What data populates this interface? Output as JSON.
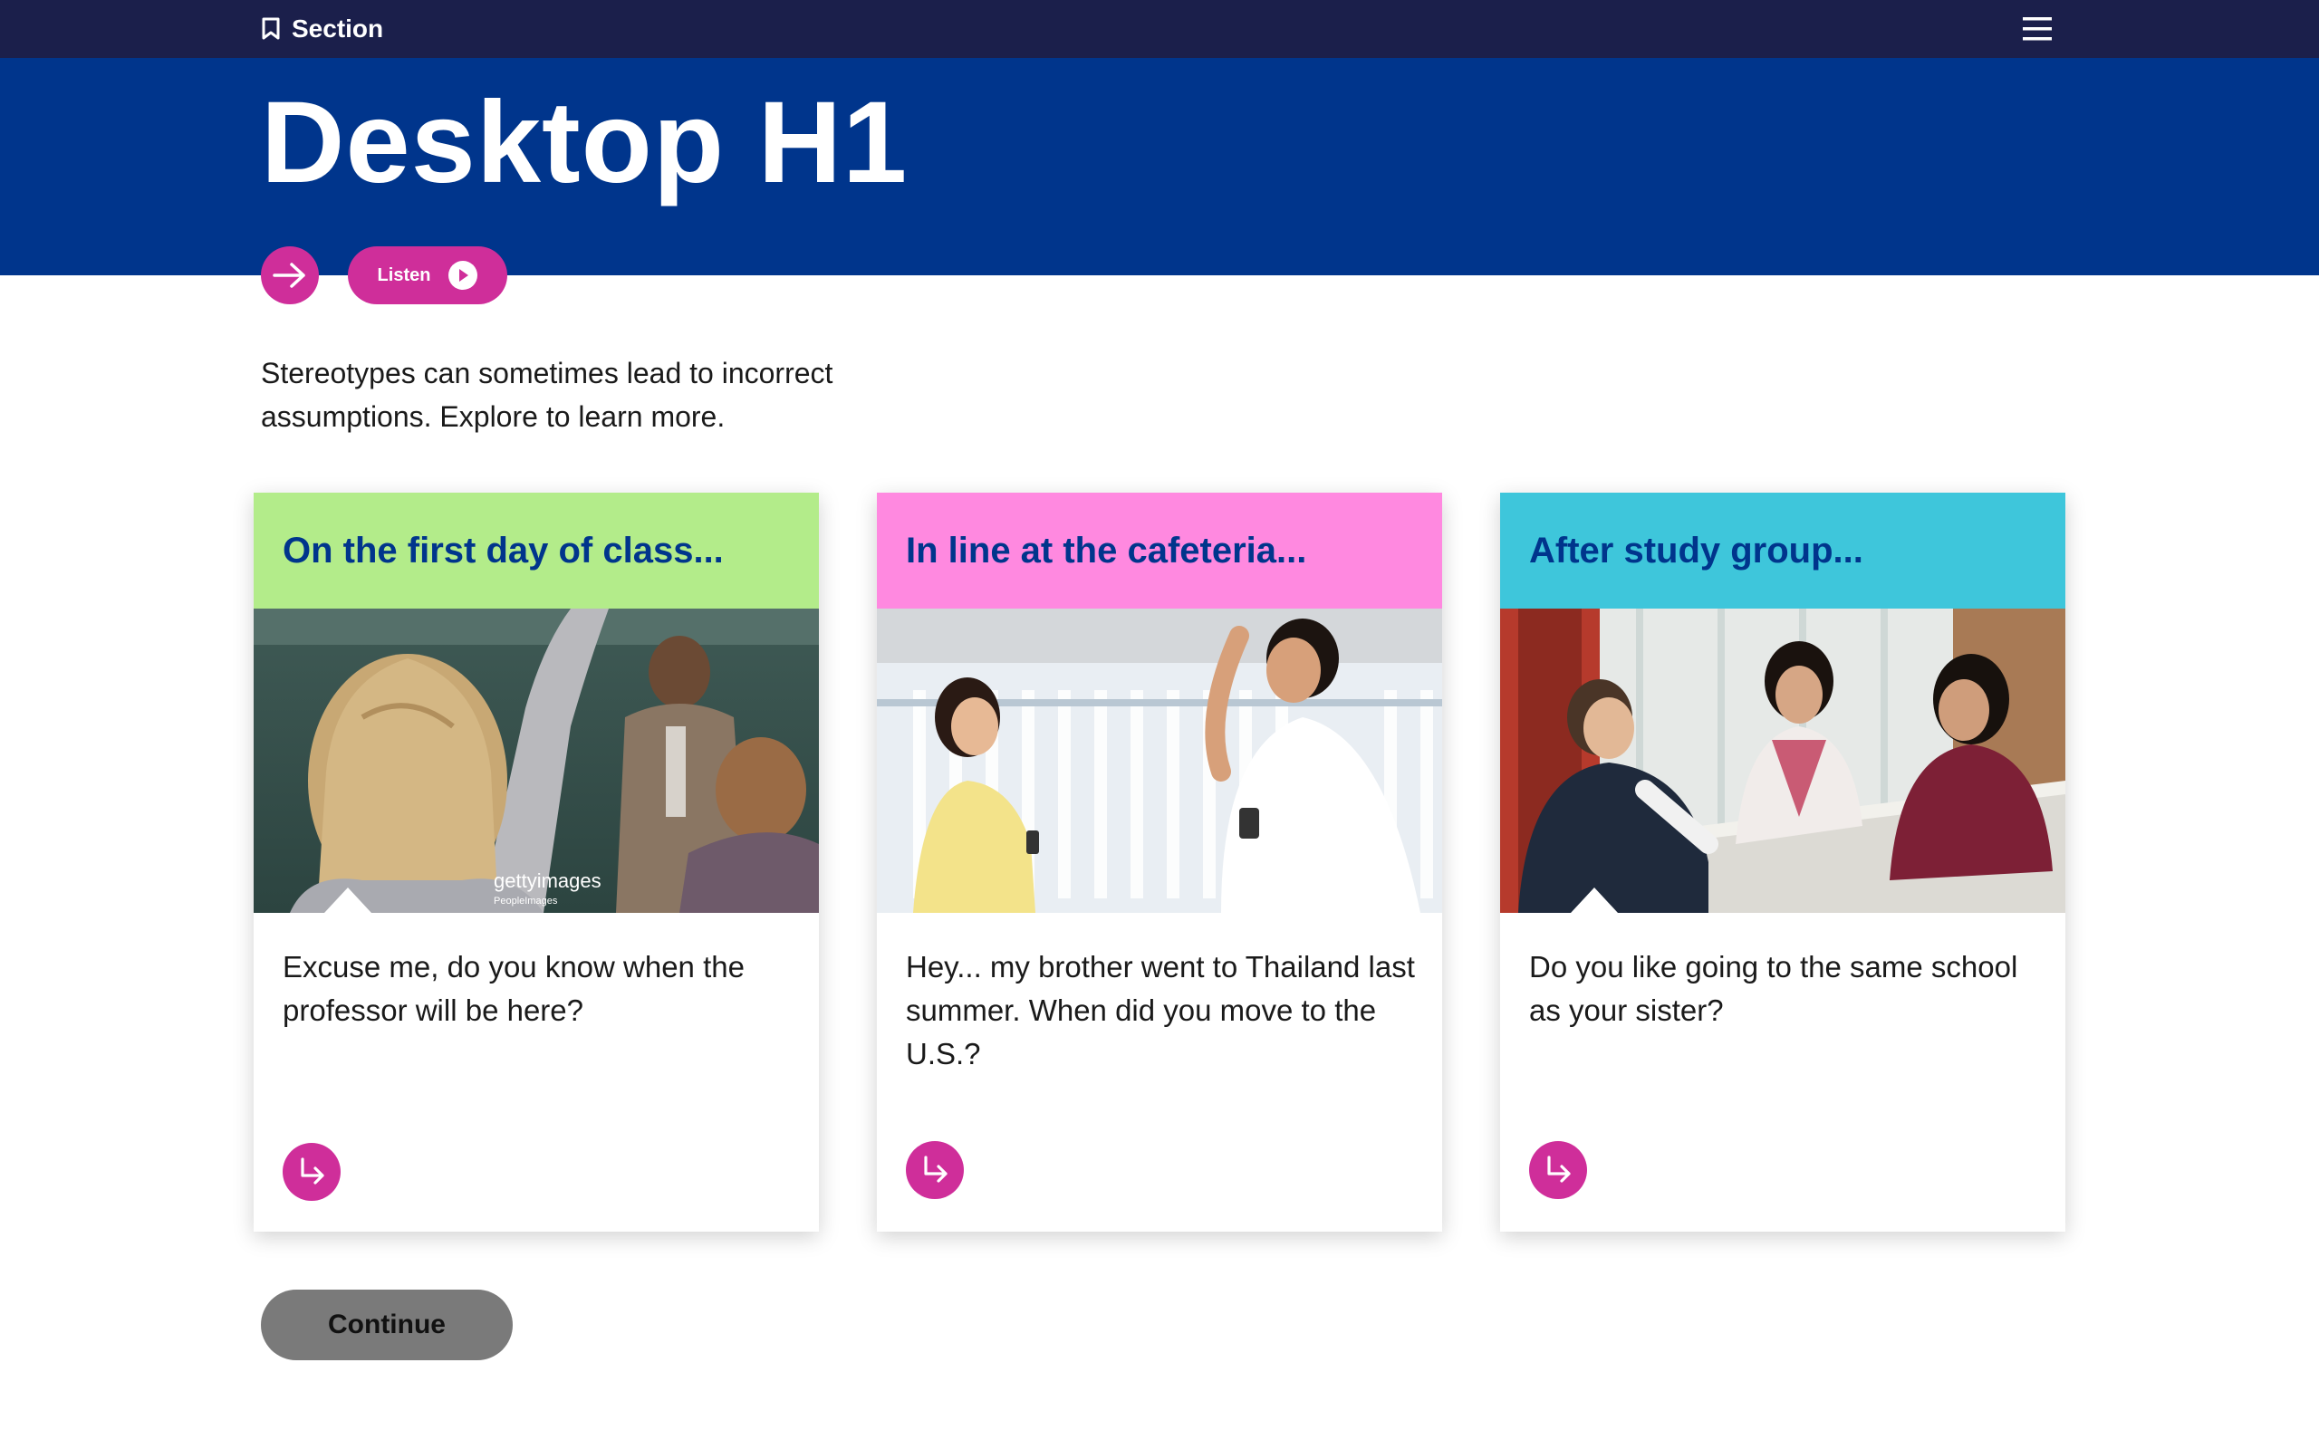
{
  "topbar": {
    "section_label": "Section",
    "section_icon": "bookmark-icon",
    "menu_icon": "hamburger-menu-icon"
  },
  "hero": {
    "title": "Desktop H1",
    "background_color": "#00358c"
  },
  "actions": {
    "next_icon": "arrow-right-icon",
    "listen_label": "Listen",
    "listen_icon": "play-icon"
  },
  "intro": {
    "text": "Stereotypes can sometimes lead to incorrect assumptions. Explore to learn more."
  },
  "cards": [
    {
      "title": "On the first day of class...",
      "header_color": "#b3ec8a",
      "image_caption": "gettyimages",
      "image_subcaption": "PeopleImages",
      "text": "Excuse me, do you know when the professor will be here?",
      "button_icon": "arrow-turn-down-right-icon"
    },
    {
      "title": "In line at the cafeteria...",
      "header_color": "#ff89e0",
      "text": "Hey... my brother went to Thailand last summer. When did you move to the U.S.?",
      "button_icon": "arrow-turn-down-right-icon"
    },
    {
      "title": "After study group...",
      "header_color": "#3ec6db",
      "text": "Do you like going to the same school as your sister?",
      "button_icon": "arrow-turn-down-right-icon"
    }
  ],
  "footer": {
    "continue_label": "Continue"
  },
  "colors": {
    "accent": "#cf2e9a",
    "topbar": "#1b1f4b",
    "continue_button": "#7a7a7a"
  }
}
